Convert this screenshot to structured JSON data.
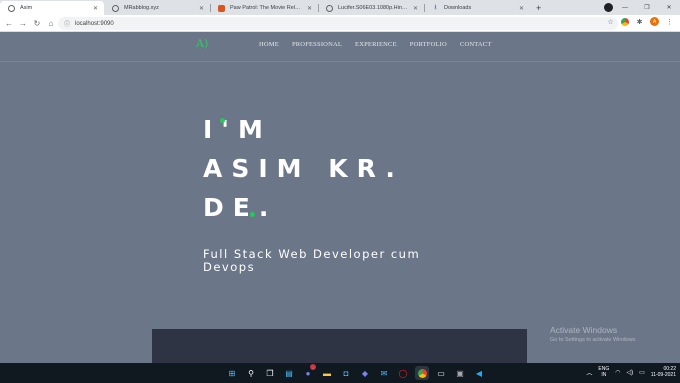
{
  "browser": {
    "tabs": [
      {
        "title": "Asim",
        "active": true
      },
      {
        "title": "MRabblog.xyz",
        "active": false
      },
      {
        "title": "Paw Patrol: The Movie Release O",
        "active": false
      },
      {
        "title": "Lucifer.S06E03.1080p.Hindi.Engli",
        "active": false
      },
      {
        "title": "Downloads",
        "active": false
      }
    ],
    "new_tab": "+",
    "url": "localhost:9090",
    "profile_initial": "A"
  },
  "site": {
    "logo": "A)",
    "nav": [
      "HOME",
      "PROFESSIONAL",
      "EXPERIENCE",
      "PORTFOLIO",
      "CONTACT"
    ],
    "hero": {
      "line1": "I'M",
      "line2": "ASIM KR.",
      "line3": "DE.",
      "subtitle": "Full Stack Web Developer cum Devops"
    },
    "accent_color": "#28c75a"
  },
  "watermark": {
    "title": "Activate Windows",
    "subtitle": "Go to Settings to activate Windows."
  },
  "taskbar": {
    "language": "ENG",
    "region": "IN",
    "time": "00:22",
    "date": "11-09-2021",
    "notification_badge": "1"
  }
}
